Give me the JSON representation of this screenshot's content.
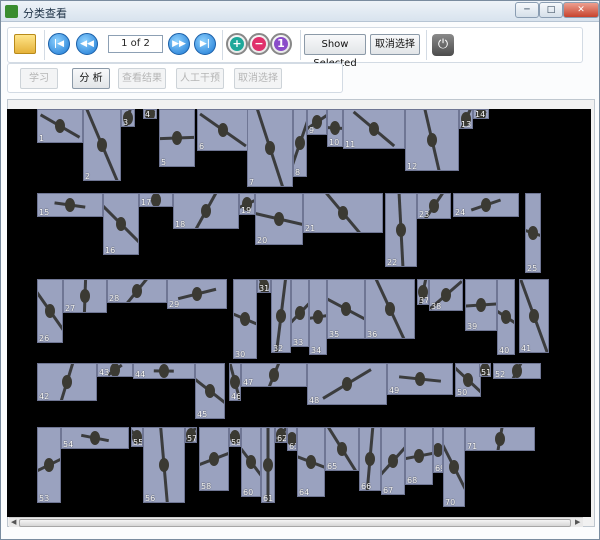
{
  "window": {
    "title": "分类查看",
    "controls": {
      "min": "─",
      "max": "□",
      "close": "✕"
    }
  },
  "toolbar": {
    "page_display": "1 of 2",
    "show_selected_label": "Show Selected",
    "cancel_select_label": "取消选择"
  },
  "toolbar2": {
    "learn_label": "学习",
    "analyze_label": "分 析",
    "view_result_label": "查看结果",
    "manual_label": "人工干预",
    "cancel_select_label": "取消选择"
  },
  "images": [
    {
      "n": "1"
    },
    {
      "n": "2"
    },
    {
      "n": "3"
    },
    {
      "n": "4"
    },
    {
      "n": "5"
    },
    {
      "n": "6"
    },
    {
      "n": "7"
    },
    {
      "n": "8"
    },
    {
      "n": "9"
    },
    {
      "n": "10"
    },
    {
      "n": "11"
    },
    {
      "n": "12"
    },
    {
      "n": "13"
    },
    {
      "n": "14"
    },
    {
      "n": "15"
    },
    {
      "n": "16"
    },
    {
      "n": "17"
    },
    {
      "n": "18"
    },
    {
      "n": "19"
    },
    {
      "n": "20"
    },
    {
      "n": "21"
    },
    {
      "n": "22"
    },
    {
      "n": "23"
    },
    {
      "n": "24"
    },
    {
      "n": "25"
    },
    {
      "n": "26"
    },
    {
      "n": "27"
    },
    {
      "n": "28"
    },
    {
      "n": "29"
    },
    {
      "n": "30"
    },
    {
      "n": "31"
    },
    {
      "n": "32"
    },
    {
      "n": "33"
    },
    {
      "n": "34"
    },
    {
      "n": "35"
    },
    {
      "n": "36"
    },
    {
      "n": "37"
    },
    {
      "n": "38"
    },
    {
      "n": "39"
    },
    {
      "n": "40"
    },
    {
      "n": "41"
    },
    {
      "n": "42"
    },
    {
      "n": "43"
    },
    {
      "n": "44"
    },
    {
      "n": "45"
    },
    {
      "n": "46"
    },
    {
      "n": "47"
    },
    {
      "n": "48"
    },
    {
      "n": "49"
    },
    {
      "n": "50"
    },
    {
      "n": "51"
    },
    {
      "n": "52"
    },
    {
      "n": "53"
    },
    {
      "n": "54"
    },
    {
      "n": "55"
    },
    {
      "n": "56"
    },
    {
      "n": "57"
    },
    {
      "n": "58"
    },
    {
      "n": "59"
    },
    {
      "n": "60"
    },
    {
      "n": "61"
    },
    {
      "n": "62"
    },
    {
      "n": "63"
    },
    {
      "n": "64"
    },
    {
      "n": "65"
    },
    {
      "n": "66"
    },
    {
      "n": "67"
    },
    {
      "n": "68"
    },
    {
      "n": "69"
    },
    {
      "n": "70"
    },
    {
      "n": "71"
    }
  ]
}
